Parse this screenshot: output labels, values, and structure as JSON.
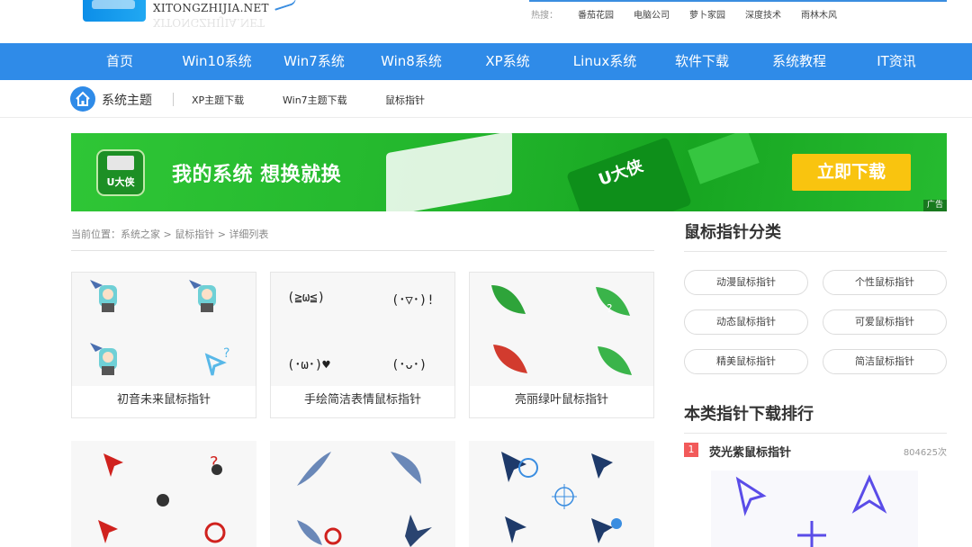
{
  "header": {
    "site_name": "XITONGZHIJIA.NET",
    "hot_label": "热搜：",
    "hot_words": [
      "番茄花园",
      "电脑公司",
      "萝卜家园",
      "深度技术",
      "雨林木风"
    ]
  },
  "nav": [
    "首页",
    "Win10系统",
    "Win7系统",
    "Win8系统",
    "XP系统",
    "Linux系统",
    "软件下载",
    "系统教程",
    "IT资讯"
  ],
  "subnav": {
    "title": "系统主题",
    "links": [
      "XP主题下载",
      "Win7主题下载",
      "鼠标指针"
    ]
  },
  "banner": {
    "usb_label": "U大侠",
    "slogan": "我的系统 想换就换",
    "product": "U大侠",
    "button": "立即下载",
    "ad_label": "广告"
  },
  "breadcrumb": {
    "prefix": "当前位置：",
    "items": [
      "系统之家",
      "鼠标指针",
      "详细列表"
    ],
    "sep": " > "
  },
  "cards": [
    {
      "name": "初音未来鼠标指针",
      "theme": "miku"
    },
    {
      "name": "手绘简洁表情鼠标指针",
      "theme": "emoji"
    },
    {
      "name": "亮丽绿叶鼠标指针",
      "theme": "leaf"
    }
  ],
  "emoji_faces": [
    "(≧ω≦)",
    "(･▽･)!",
    "(･ω･)♥",
    "(･ᴗ･)"
  ],
  "sidebar": {
    "category_title": "鼠标指针分类",
    "categories": [
      "动漫鼠标指针",
      "个性鼠标指针",
      "动态鼠标指针",
      "可爱鼠标指针",
      "精美鼠标指针",
      "简洁鼠标指针"
    ],
    "rank_title": "本类指针下载排行",
    "rank": [
      {
        "no": "1",
        "name": "荧光紫鼠标指针",
        "count": "804625次"
      }
    ]
  },
  "colors": {
    "nav_bg": "#2f8be8",
    "banner_green": "#22b52c",
    "button_yellow": "#f9c40f",
    "rank_red": "#f25a5a"
  }
}
